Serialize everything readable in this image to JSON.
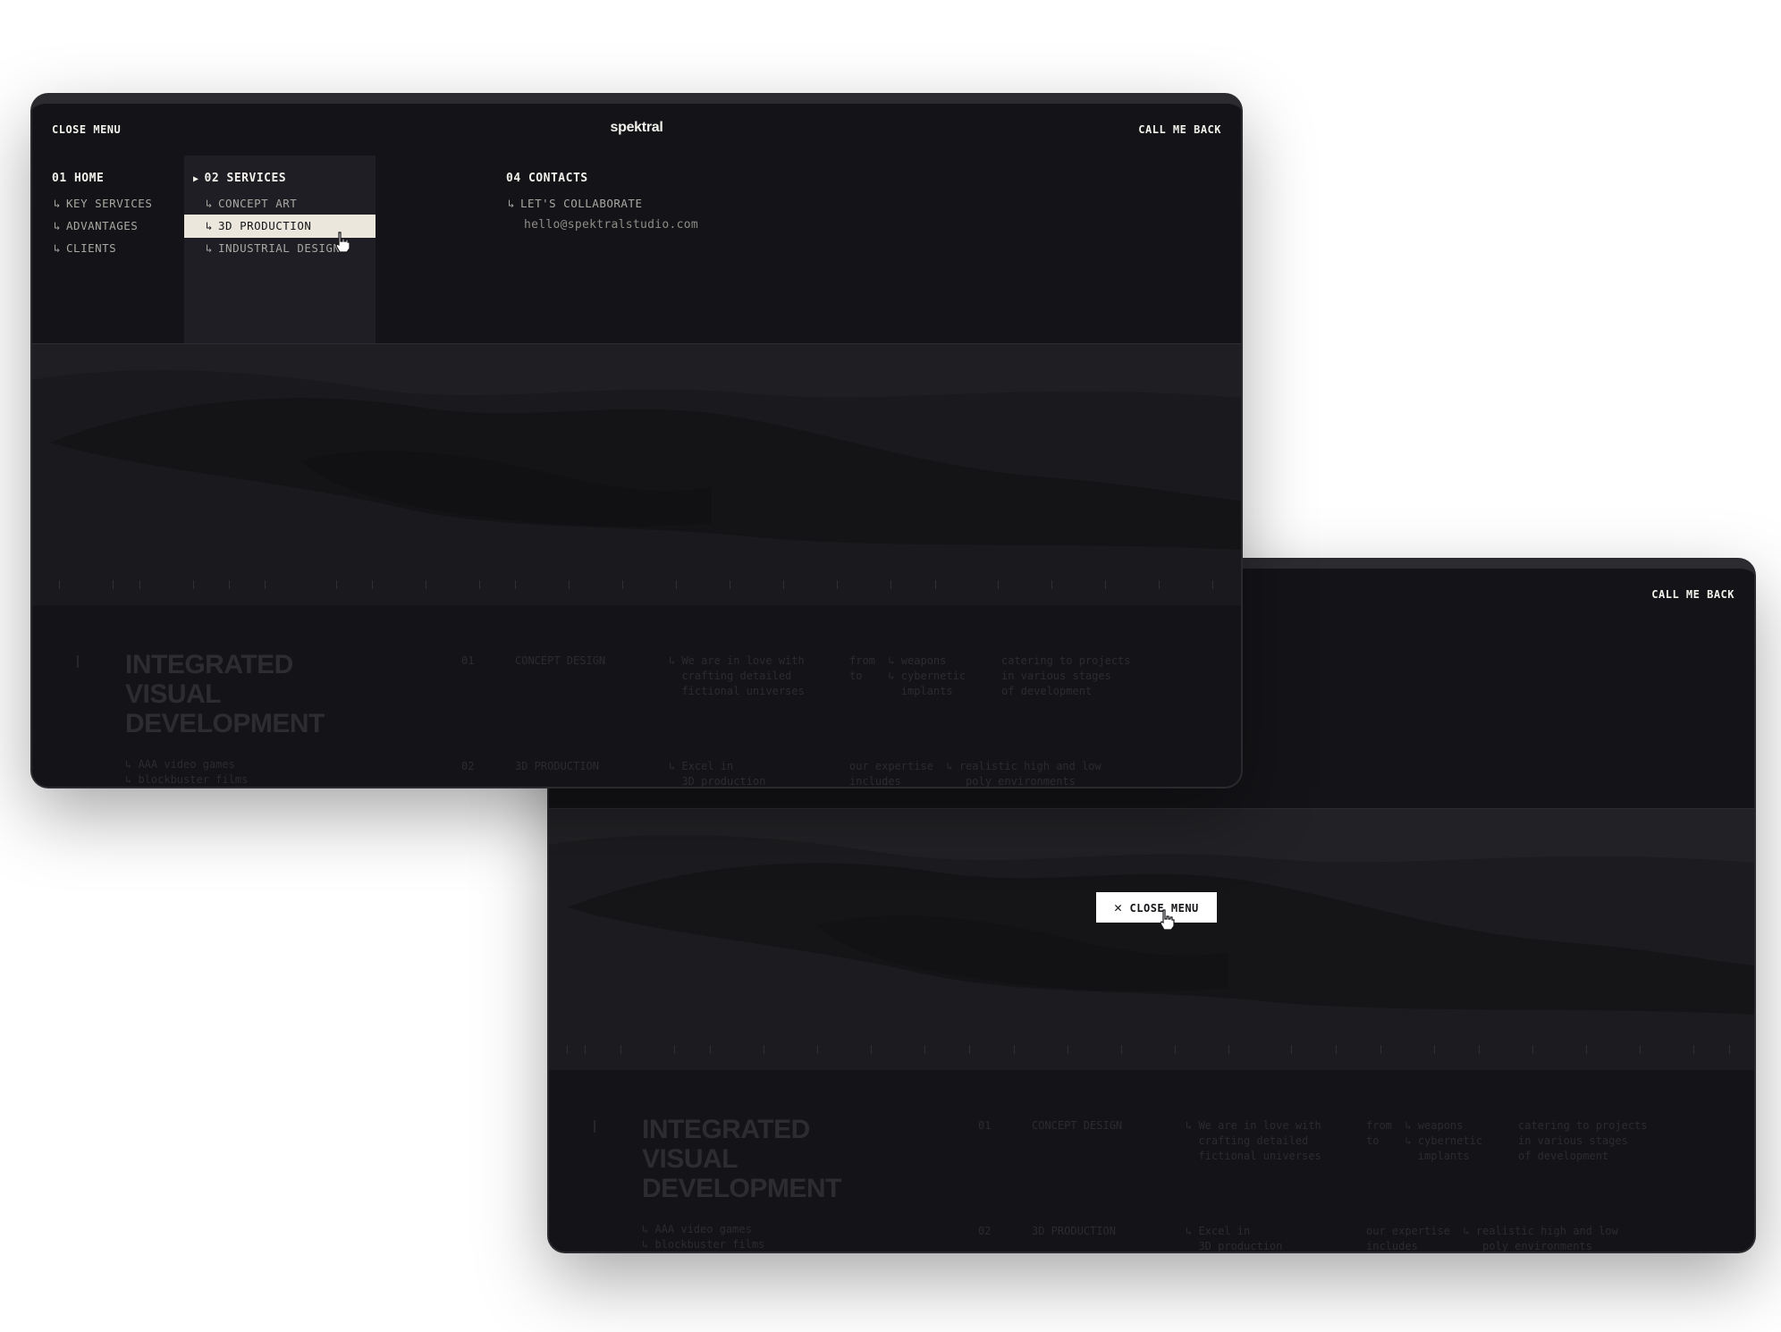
{
  "brand": {
    "logo": "spektral"
  },
  "header": {
    "close_menu": "CLOSE MENU",
    "call_me_back": "CALL ME BACK"
  },
  "menu": {
    "home": {
      "label": "01 HOME",
      "items": [
        "KEY SERVICES",
        "ADVANTAGES",
        "CLIENTS"
      ]
    },
    "services": {
      "label": "02 SERVICES",
      "items": [
        "CONCEPT ART",
        "3D PRODUCTION",
        "INDUSTRIAL DESIGN"
      ],
      "active_index": 1
    },
    "contacts": {
      "label": "04 CONTACTS",
      "items": [
        "LET'S COLLABORATE"
      ],
      "email": "hello@spektralstudio.com"
    }
  },
  "hero": {
    "title_lines": [
      "INTEGRATED",
      "VISUAL",
      "DEVELOPMENT"
    ],
    "subtitle_lines": [
      "↳ AAA video games",
      "↳ blockbuster films"
    ]
  },
  "services_rows": [
    {
      "num": "01",
      "name": "CONCEPT DESIGN",
      "desc": "↳ We are in love with\n  crafting detailed\n  fictional universes",
      "range": "from  ↳ weapons\nto    ↳ cybernetic\n        implants",
      "note": "catering to projects\nin various stages\nof development"
    },
    {
      "num": "02",
      "name": "3D PRODUCTION",
      "desc": "↳ Excel in\n  3D production",
      "range": "our expertise  ↳ realistic high and low\nincludes          poly environments",
      "note": ""
    }
  ],
  "floating_button": {
    "icon": "close-icon",
    "label": "CLOSE MENU"
  },
  "colors": {
    "bg": "#141418",
    "panel": "#1e1e24",
    "active": "#ece7dc",
    "text": "#f2f0ea",
    "muted": "#a9a7a1"
  }
}
